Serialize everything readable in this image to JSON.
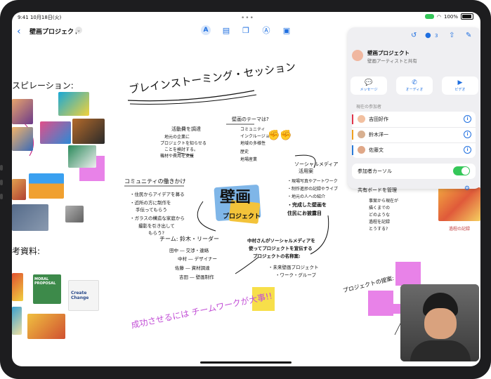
{
  "status": {
    "time": "9:41",
    "date": "10月18日(火)",
    "battery": "100%"
  },
  "toolbar": {
    "back_icon": "chevron-left-icon",
    "title": "壁画プロジェクト",
    "participant_count": "3"
  },
  "panel": {
    "title": "壁画プロジェクト",
    "subtitle": "壁画アーティストと共有",
    "actions": [
      {
        "label": "メッセージ",
        "icon": "message-icon"
      },
      {
        "label": "オーディオ",
        "icon": "phone-icon"
      },
      {
        "label": "ビデオ",
        "icon": "video-icon"
      }
    ],
    "section_label": "現在の参加者",
    "participants": [
      {
        "name": "吉田好作",
        "color": "#e0344b"
      },
      {
        "name": "鈴木洋一",
        "color": "#f0a020"
      },
      {
        "name": "佐藤文",
        "color": "#2a7ad8"
      }
    ],
    "cursor_label": "参加者カーソル",
    "manage_label": "共有ボードを管理"
  },
  "board": {
    "heading": "ブレインストーミング・セッション",
    "left_top": "スピレーション:",
    "left_mid": "考資料:",
    "center_logo_1": "壁画",
    "center_logo_2": "プロジェクト",
    "q1_title": "活動費を調達",
    "q1_lines": [
      "地元の企業に",
      "プロジェクトを知らせる",
      "ことを検討する。",
      "機材や費用を支援"
    ],
    "theme_title": "壁画のテーマは?",
    "theme_lines": [
      "コミュニティ",
      "インクルージョン",
      "地域の多様性",
      "歴史",
      "地場産業"
    ],
    "community_title": "コミュニティの働きかけ",
    "community_lines": [
      "・住民からアイデアを募る",
      "・近所の方に制作を",
      "手伝ってもらう",
      "・ガラスの構造な家庭から",
      "撮影を引き出して",
      "もらう?"
    ],
    "team_title": "チーム: 鈴木・リーダー",
    "team_lines": [
      "田中 ― 交渉・連絡",
      "中村 ― デザイナー",
      "佐藤 ― 資材調達",
      "吉田 ― 壁画制作"
    ],
    "social_title": "ソーシャルメディア",
    "social_title2": "活用案",
    "social_lines": [
      "・現場写真やアートワーク",
      "・制作進捗の記録やライブ",
      "・地元の人への紹介",
      "・完成した壁画を",
      "住民にお披露目"
    ],
    "nakamura_lines": [
      "中村さんがソーシャルメディアを",
      "使ってプロジェクトを宣伝する",
      "プロジェクトの名称案:"
    ],
    "name_lines": [
      "・未来壁画プロジェクト",
      "・ワーク・グループ"
    ],
    "sticky_yellow": "",
    "slogan": "成功させるには チームワークが大事!!",
    "proposals_label": "プロジェクトの提案:",
    "right_lines": [
      "事案から現在が",
      "描くまでの",
      "どのような",
      "過程を記録",
      "とうする?"
    ],
    "materials_label": "過程の記録"
  },
  "reference_cards": [
    {
      "title": "MORAL PROPOSAL"
    },
    {
      "title": "Create Change"
    }
  ],
  "colors": {
    "accent": "#1f6fe0",
    "toggle": "#35c759",
    "sticky_pink": "#e882e8",
    "sticky_yellow": "#f7df4a"
  }
}
